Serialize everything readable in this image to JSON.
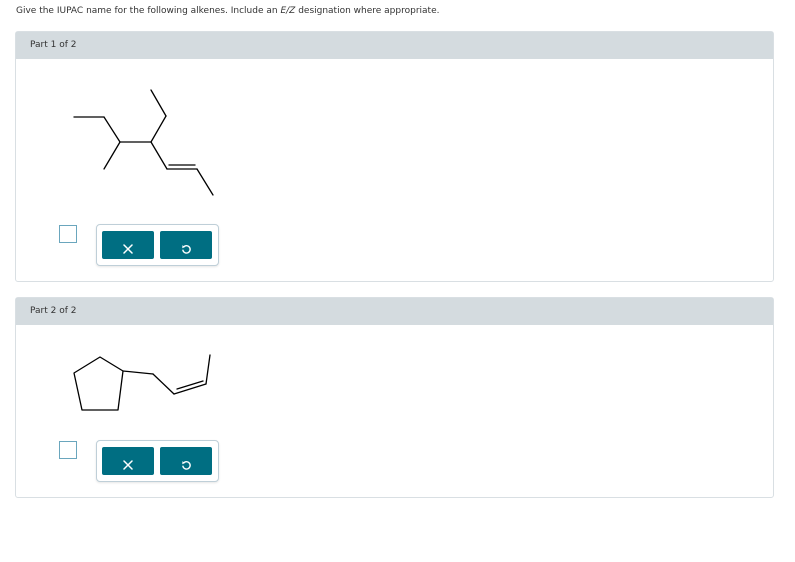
{
  "instructions": {
    "before": "Give the IUPAC name for the following alkenes. Include an ",
    "ez": "E/Z",
    "after": " designation where appropriate."
  },
  "parts": [
    {
      "label": "Part 1 of 2",
      "answer_value": "",
      "clear_icon": "close-icon",
      "reset_icon": "undo-icon"
    },
    {
      "label": "Part 2 of 2",
      "answer_value": "",
      "clear_icon": "close-icon",
      "reset_icon": "undo-icon"
    }
  ],
  "colors": {
    "header_bg": "#d4dbdf",
    "button_bg": "#006e82",
    "answer_border": "#6aa6bd"
  }
}
